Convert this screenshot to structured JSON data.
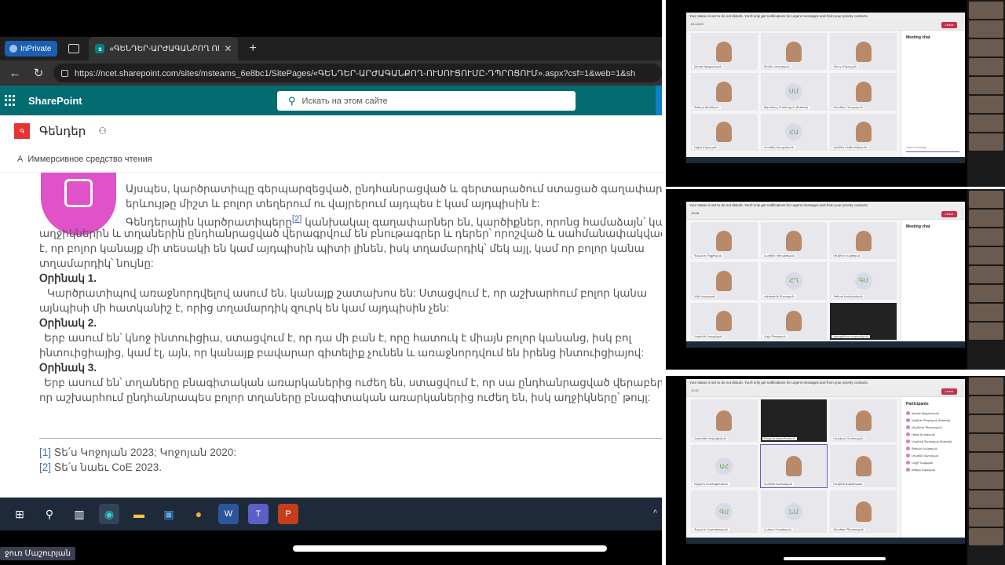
{
  "browser": {
    "inprivate_label": "InPrivate",
    "tab_title": "«ԳԵՆԴԵՐ-ԱՐԺԱԳԱՆԲՈՂ ՈՒՍ",
    "url": "https://ncet.sharepoint.com/sites/msteams_6e8bc1/SitePages/«ԳԵՆԴԵՐ-ԱՐԺԱԳԱՆՔՈՂ-ՈՒՍՈՒՑՈՒՄԸ-ԴՊՐՈՑՈՒՄ».aspx?csf=1&web=1&sh"
  },
  "sharepoint": {
    "app_name": "SharePoint",
    "search_placeholder": "Искать на этом сайте",
    "site_name": "Գենդեր",
    "reader_label": "Иммерсивное средство чтения"
  },
  "doc": {
    "line1": "Այսպես, կարծրատիպը գերպարզեցված, ընդհանրացված և գերտարածում ստացած գաղափար է",
    "line2": "երևույթը միշտ և բոլոր տեղերում ու վայրերում այդպես է կամ այդպիսին է:",
    "line3_a": "Գենդերային կարծրատիպերը",
    "line3_ref": "[2]",
    "line3_b": " կանխակալ գաղափարներ են, կարծիքներ, որոնց համաձայն՝ կա",
    "line4": "աղջիկներին և տղաներին ընդհանրացված վերագրվում են բնութագրեր և դերեր՝ որոշված և սահմանափակված",
    "line5": "է, որ բոլոր կանայք մի տեսակի են կամ այդպիսին պիտի լինեն, իսկ տղամարդիկ՝ մեկ այլ, կամ որ բոլոր կանա",
    "line6": "տղամարդիկ՝ նույնը:",
    "ex1_title": "Օրինակ 1.",
    "ex1_l1": "Կարծրատիպով առաջնորդվելով ասում են. կանայք շատախոս են: Ստացվում է, որ աշխարհում բոլոր կանա",
    "ex1_l2": "այնպիսի մի հատկանիշ է, որից տղամարդիկ զուրկ են կամ այդպիսին չեն:",
    "ex2_title": "Օրինակ 2.",
    "ex2_l1": "Երբ ասում են՝ կնոջ ինտուիցիա,   ստացվում է, որ դա մի բան է, որը հատուկ է միայն բոլոր կանանց, իսկ բոլ",
    "ex2_l2": "ինտուիցիայից, կամ էլ, այն, որ կանայք բավարար գիտելիք չունեն և առաջնորդվում են իրենց ինտուիցիայով:",
    "ex3_title": "Օրինակ 3.",
    "ex3_l1": "Երբ ասում են՝ տղաները բնագիտական առարկաներից ուժեղ են, ստացվում է, որ սա ընդհանրացված վերաբերմ",
    "ex3_l2": "որ աշխարհում ընդհանրապես բոլոր տղաները բնագիտական առարկաներից ուժեղ են, իսկ աղջիկները՝  թույլ:",
    "fn1_num": "[1]",
    "fn1_text": " Տե՛ս Կոջոյան 2023; Կոջոյան 2020:",
    "fn2_num": "[2]",
    "fn2_text": " Տե՛ս նաեւ CoE 2023."
  },
  "presenter_name": "ջուռ Մաշուրյան",
  "meeting": {
    "chat_title": "Meeting chat",
    "participants_title": "Participants",
    "type_message": "Type a message",
    "leave_label": "Leave",
    "timers": [
      "01:13:33",
      "12:08",
      "17:47"
    ],
    "shot1_tiles": [
      {
        "label": "Սյուզի Ալեքսանյան",
        "kind": "photo"
      },
      {
        "label": "Ռիմմա Սարգսյան",
        "kind": "face"
      },
      {
        "label": "Անուշ Մկրտչյան",
        "kind": "face"
      },
      {
        "label": "Գոհար Սիմոնյան",
        "kind": "face"
      },
      {
        "label": "Սիրանուշ Մանուկյան (External)",
        "kind": "initials",
        "initials": "ՍՄ"
      },
      {
        "label": "Անահիտ Ղազարյան",
        "kind": "face"
      },
      {
        "label": "Լիլիթ Մկրտչյան",
        "kind": "face"
      },
      {
        "label": "Հասմիկ Աղաջանյան",
        "kind": "initials",
        "initials": "ՀԱ"
      },
      {
        "label": "Արմինե Հովհաննիսյան",
        "kind": "face"
      }
    ],
    "shot2_tiles": [
      {
        "label": "Գայանե Մելքոնյան",
        "kind": "face"
      },
      {
        "label": "Նարինե Կիրակոսյան",
        "kind": "face"
      },
      {
        "label": "Լուսինե Հակոբյան",
        "kind": "face"
      },
      {
        "label": "Անի Սարգսյան",
        "kind": "face"
      },
      {
        "label": "Հռիփսիմե Գևորգյան",
        "kind": "initials",
        "initials": "ՀԴ"
      },
      {
        "label": "Գոհար Ստեփանյան",
        "kind": "initials",
        "initials": "ԳՍ"
      },
      {
        "label": "Մարինե Առաքելյան",
        "kind": "face"
      },
      {
        "label": "Նելլի Պողոսյան",
        "kind": "face"
      },
      {
        "label": "Սյուզաննա Վարդանյան",
        "kind": "dark"
      }
    ],
    "shot3_tiles": [
      {
        "label": "Զարուհի Հովակիմյան",
        "kind": "face"
      },
      {
        "label": "Ռուզան Աբրահամյան",
        "kind": "dark"
      },
      {
        "label": "Մարիամ Մանուկյան",
        "kind": "face"
      },
      {
        "label": "Ալվարդ Հարությունյան",
        "kind": "initials",
        "initials": "ԱՀ"
      },
      {
        "label": "Կարինե Սահակյան",
        "kind": "face",
        "sel": true
      },
      {
        "label": "Լուսինե Ավետիսյան",
        "kind": "face"
      },
      {
        "label": "Գայանե Մարտիրոսյան",
        "kind": "initials",
        "initials": "ԳՄ"
      },
      {
        "label": "Նաիրա Մովսիսյան",
        "kind": "initials",
        "initials": "ՆՄ"
      },
      {
        "label": "Անահիտ Պետրոսյան",
        "kind": "face"
      }
    ],
    "participants": [
      "Սյուզի Ալեքսանյան",
      "Արմինե Պողոսյան (External)",
      "Անահիտ Պետրոսյան",
      "Լիլիթ Սարգսյան",
      "Մարինե Գևորգյան (External)",
      "Գոհար Հակոբյան",
      "Լուսինե Մկրտչյան",
      "Նելլի Դավթյան",
      "Սոֆյա Ավագյան"
    ]
  }
}
